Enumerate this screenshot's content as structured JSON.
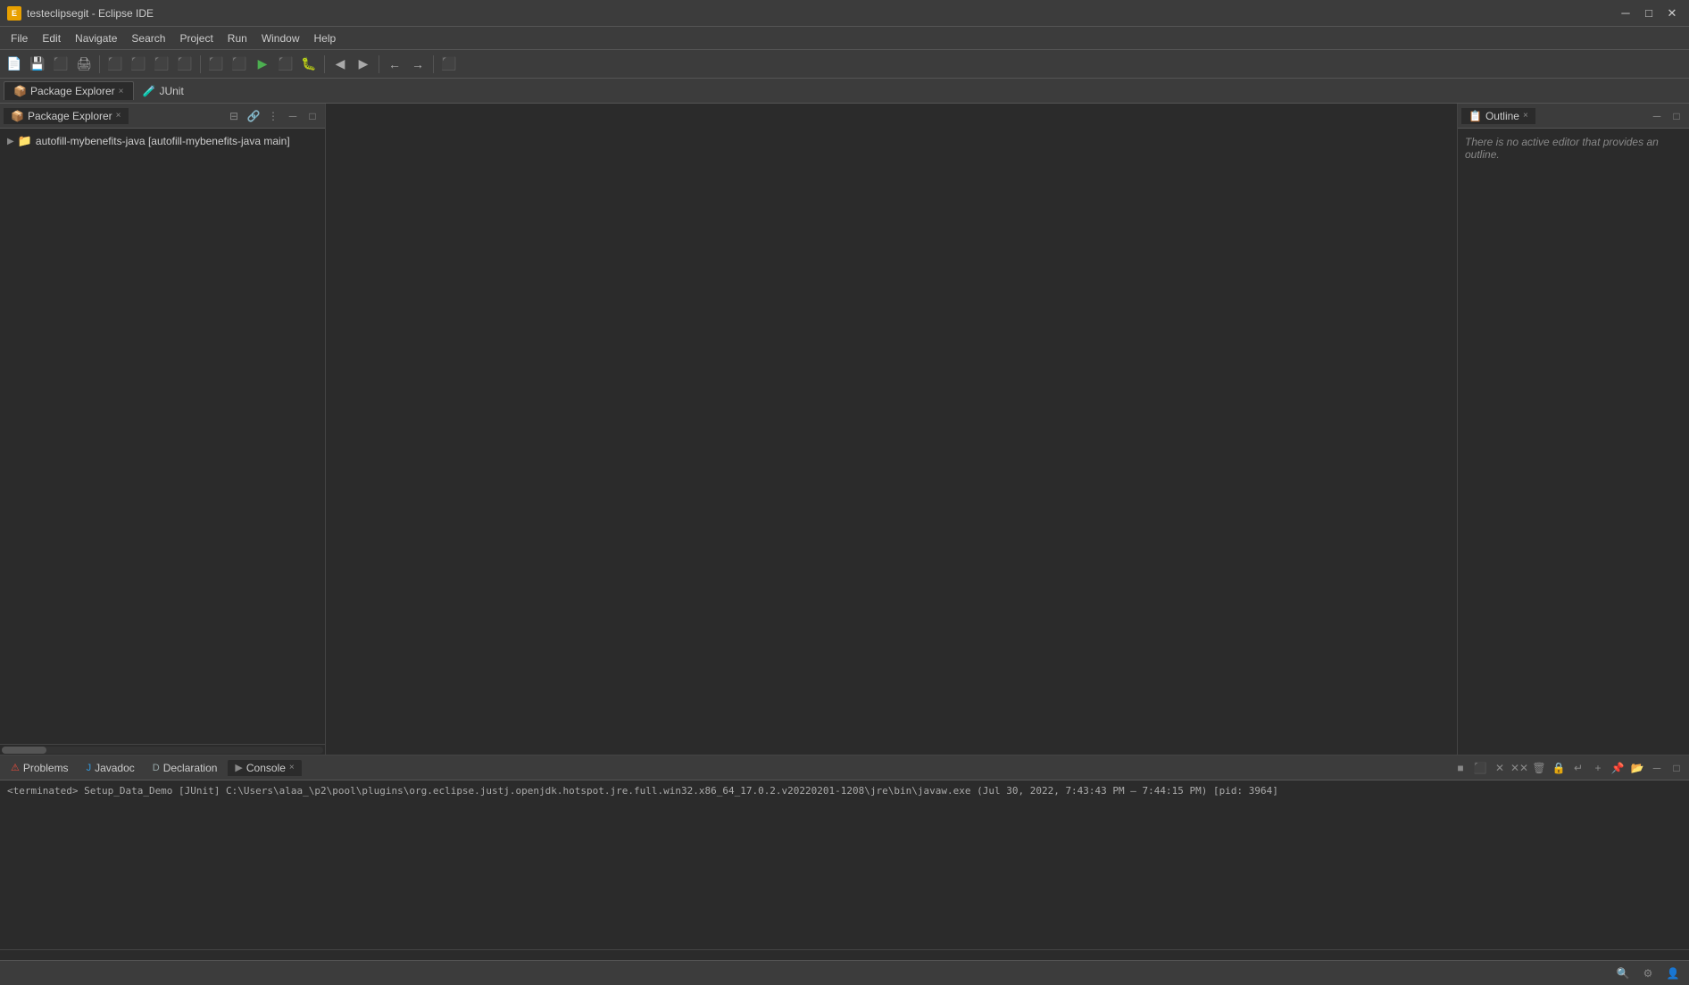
{
  "window": {
    "title": "testeclipsegit - Eclipse IDE",
    "icon": "E"
  },
  "titlebar": {
    "minimize": "─",
    "maximize": "□",
    "close": "✕"
  },
  "menubar": {
    "items": [
      "File",
      "Edit",
      "Navigate",
      "Search",
      "Project",
      "Run",
      "Window",
      "Help"
    ]
  },
  "toolbar": {
    "buttons": [
      "⬛",
      "⬛",
      "⬛",
      "⬛",
      "⬛",
      "⬛",
      "⬛",
      "⬛",
      "⬛",
      "⬛",
      "⬛",
      "⬛",
      "⬛",
      "⬛",
      "⬛",
      "⬛",
      "⬛",
      "⬛",
      "⬛",
      "⬛",
      "⬛"
    ]
  },
  "perspective_bar": {
    "tabs": [
      {
        "id": "package-explorer-tab",
        "label": "Package Explorer",
        "active": true,
        "closeable": true
      },
      {
        "id": "junit-tab",
        "label": "JUnit",
        "active": false,
        "closeable": false
      }
    ]
  },
  "left_panel": {
    "title": "Package Explorer",
    "tree_items": [
      {
        "label": "autofill-mybenefits-java [autofill-mybenefits-java main]",
        "level": 1,
        "expanded": false,
        "has_arrow": true
      }
    ]
  },
  "outline_panel": {
    "title": "Outline",
    "no_editor_message": "There is no active editor that provides an outline."
  },
  "bottom_panel": {
    "tabs": [
      {
        "id": "problems-tab",
        "label": "Problems",
        "icon": "⚠",
        "active": false,
        "closeable": false
      },
      {
        "id": "javadoc-tab",
        "label": "Javadoc",
        "icon": "J",
        "active": false,
        "closeable": false
      },
      {
        "id": "declaration-tab",
        "label": "Declaration",
        "icon": "D",
        "active": false,
        "closeable": false
      },
      {
        "id": "console-tab",
        "label": "Console",
        "icon": "▶",
        "active": true,
        "closeable": true
      }
    ],
    "console_output": "<terminated> Setup_Data_Demo [JUnit] C:\\Users\\alaa_\\p2\\pool\\plugins\\org.eclipse.justj.openjdk.hotspot.jre.full.win32.x86_64_17.0.2.v20220201-1208\\jre\\bin\\javaw.exe  (Jul 30, 2022, 7:43:43 PM – 7:44:15 PM) [pid: 3964]"
  },
  "status_bar": {
    "items": [],
    "right_icons": [
      "🔍",
      "⚙",
      "👤"
    ]
  }
}
